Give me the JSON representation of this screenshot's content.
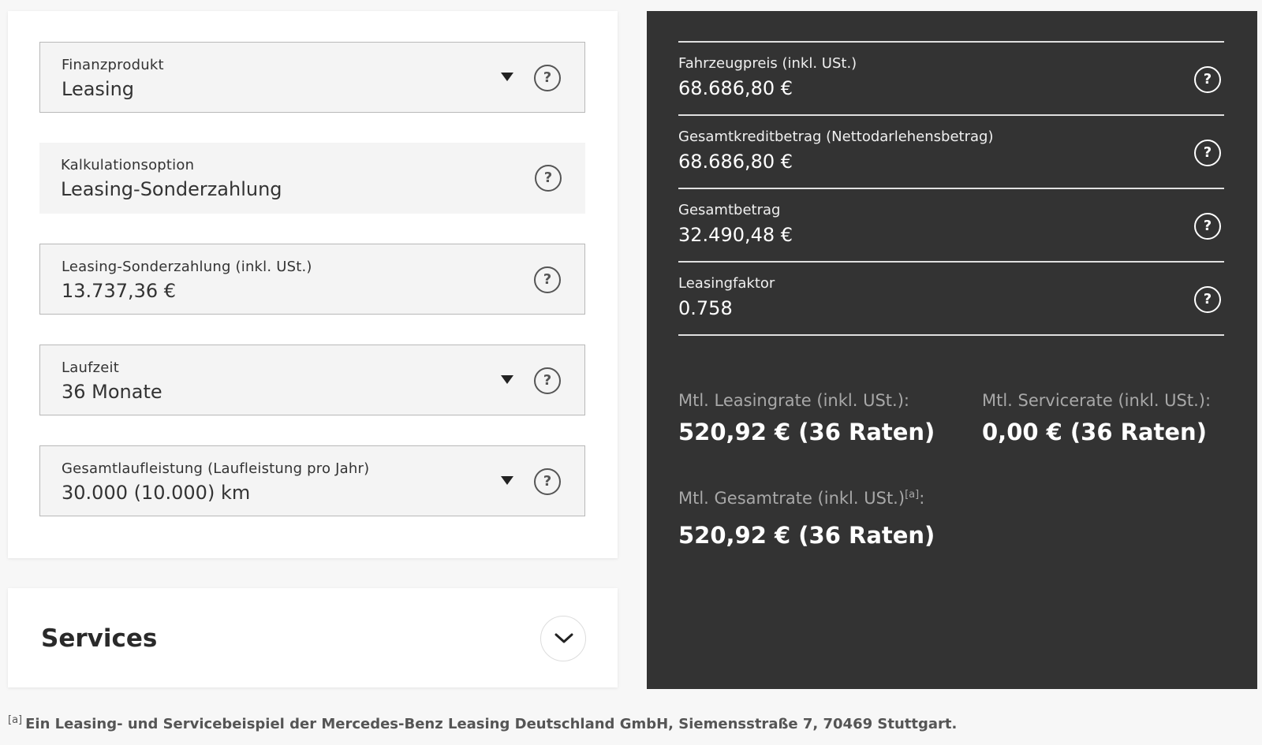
{
  "left": {
    "fields": [
      {
        "label": "Finanzprodukt",
        "value": "Leasing",
        "dropdown": true
      },
      {
        "label": "Kalkulationsoption",
        "value": "Leasing-Sonderzahlung",
        "dropdown": false
      },
      {
        "label": "Leasing-Sonderzahlung (inkl. USt.)",
        "value": "13.737,36 €",
        "dropdown": false
      },
      {
        "label": "Laufzeit",
        "value": "36 Monate",
        "dropdown": true
      },
      {
        "label": "Gesamtlaufleistung (Laufleistung pro Jahr)",
        "value": "30.000 (10.000) km",
        "dropdown": true
      }
    ],
    "help_glyph": "?"
  },
  "services": {
    "title": "Services",
    "icon": "chevron-down-icon"
  },
  "right": {
    "rows": [
      {
        "label": "Fahrzeugpreis (inkl. USt.)",
        "value": "68.686,80 €"
      },
      {
        "label": "Gesamtkreditbetrag (Nettodarlehensbetrag)",
        "value": "68.686,80 €"
      },
      {
        "label": "Gesamtbetrag",
        "value": "32.490,48 €"
      },
      {
        "label": "Leasingfaktor",
        "value": "0.758"
      }
    ],
    "leasing_rate": {
      "label": "Mtl. Leasingrate (inkl. USt.):",
      "value": "520,92 € (36 Raten)"
    },
    "service_rate": {
      "label": "Mtl. Servicerate (inkl. USt.):",
      "value": "0,00 € (36 Raten)"
    },
    "total_rate": {
      "label": "Mtl. Gesamtrate (inkl. USt.)",
      "footnote_ref": "[a]",
      "suffix": ":",
      "value": "520,92 € (36 Raten)"
    }
  },
  "footnote": {
    "ref": "[a]",
    "text": "Ein Leasing- und Servicebeispiel der Mercedes-Benz Leasing Deutschland GmbH, Siemensstraße 7, 70469 Stuttgart."
  },
  "colors": {
    "dark_panel": "#333333",
    "page_bg": "#f7f7f7"
  }
}
